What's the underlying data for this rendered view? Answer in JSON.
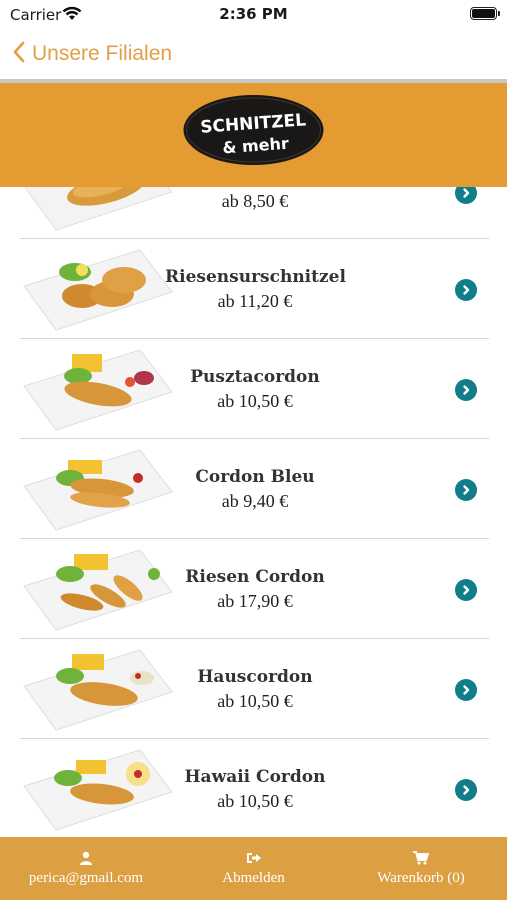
{
  "status_bar": {
    "carrier": "Carrier",
    "time": "2:36 PM"
  },
  "nav": {
    "back_label": "Unsere Filialen"
  },
  "colors": {
    "accent": "#e1a046",
    "header": "#e49b32",
    "tab_bar": "#dca043",
    "chevron": "#0f7e8a"
  },
  "logo": {
    "line1": "SCHNITZEL",
    "line2": "& mehr"
  },
  "items": [
    {
      "name": "",
      "price": "ab 8,50 €"
    },
    {
      "name": "Riesensurschnitzel",
      "price": "ab 11,20 €"
    },
    {
      "name": "Pusztacordon",
      "price": "ab 10,50 €"
    },
    {
      "name": "Cordon Bleu",
      "price": "ab 9,40 €"
    },
    {
      "name": "Riesen Cordon",
      "price": "ab 17,90 €"
    },
    {
      "name": "Hauscordon",
      "price": "ab 10,50 €"
    },
    {
      "name": "Hawaii Cordon",
      "price": "ab 10,50 €"
    }
  ],
  "tabs": [
    {
      "icon": "user-icon",
      "label": "perica@gmail.com"
    },
    {
      "icon": "sign-out-icon",
      "label": "Abmelden"
    },
    {
      "icon": "cart-icon",
      "label": "Warenkorb (0)"
    }
  ]
}
